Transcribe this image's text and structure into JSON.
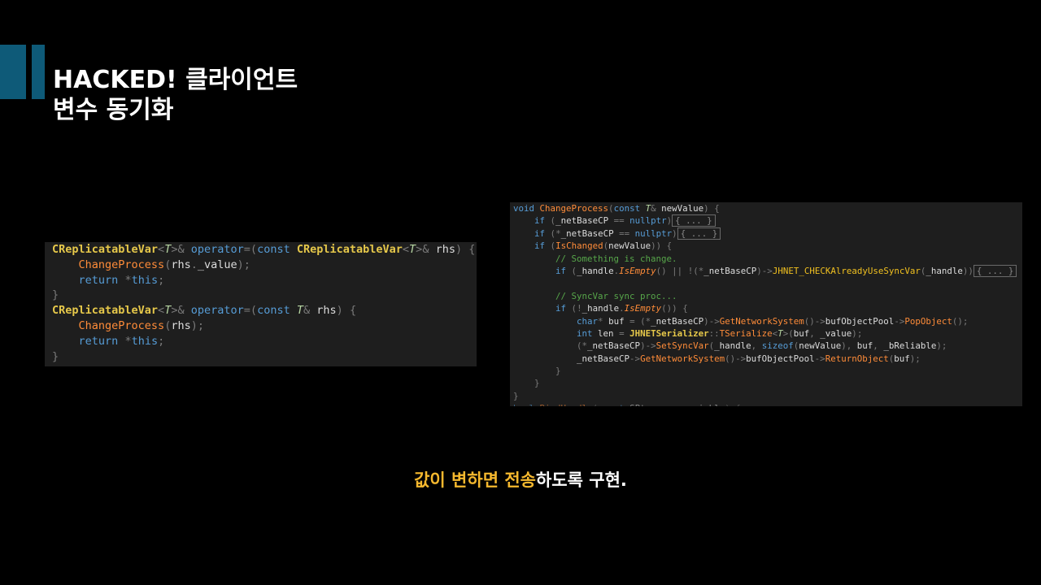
{
  "slide": {
    "title_line1": "HACKED! 클라이언트",
    "title_line2": "변수 동기화",
    "caption_highlight": "값이 변하면 전송",
    "caption_rest": "하도록 구현.",
    "accent_color": "#0e5a78",
    "highlight_color": "#f5b82e"
  },
  "left_code": {
    "lines": [
      "CReplicatableVar<T>& operator=(const CReplicatableVar<T>& rhs) {",
      "    ChangeProcess(rhs._value);",
      "    return *this;",
      "}",
      "CReplicatableVar<T>& operator=(const T& rhs) {",
      "    ChangeProcess(rhs);",
      "    return *this;",
      "}"
    ]
  },
  "right_code": {
    "fold_marker": "{ ... }",
    "lines": [
      "void ChangeProcess(const T& newValue) {",
      "    if (_netBaseCP == nullptr)",
      "    if (*_netBaseCP == nullptr)",
      "    if (IsChanged(newValue)) {",
      "        // Something is change.",
      "        if (_handle.IsEmpty() || !(*_netBaseCP)->JHNET_CHECKAlreadyUseSyncVar(_handle))",
      "",
      "        // SyncVar sync proc...",
      "        if (!_handle.IsEmpty()) {",
      "            char* buf = (*_netBaseCP)->GetNetworkSystem()->bufObjectPool->PopObject();",
      "            int len = JHNETSerializer::TSerialize<T>(buf, _value);",
      "            (*_netBaseCP)->SetSyncVar(_handle, sizeof(newValue), buf, _bReliable);",
      "            _netBaseCP->GetNetworkSystem()->bufObjectPool->ReturnObject(buf);",
      "        }",
      "    }",
      "}",
      "bool BindHandle(const SPtr<...> variable) {"
    ]
  }
}
